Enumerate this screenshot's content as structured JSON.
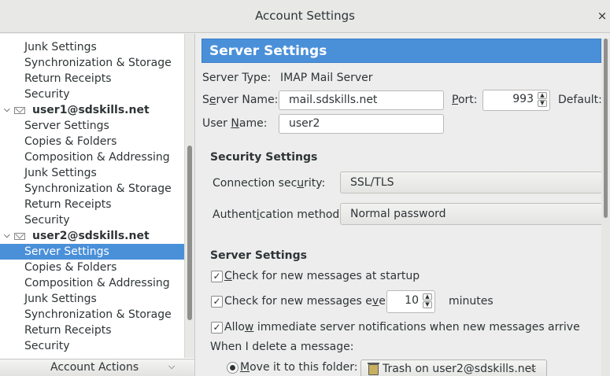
{
  "window": {
    "title": "Account Settings",
    "close_glyph": "×"
  },
  "sidebar": {
    "items": [
      {
        "label": "Junk Settings",
        "kind": "child"
      },
      {
        "label": "Synchronization & Storage",
        "kind": "child"
      },
      {
        "label": "Return Receipts",
        "kind": "child"
      },
      {
        "label": "Security",
        "kind": "child"
      },
      {
        "label": "user1@sdskills.net",
        "kind": "account"
      },
      {
        "label": "Server Settings",
        "kind": "child"
      },
      {
        "label": "Copies & Folders",
        "kind": "child"
      },
      {
        "label": "Composition & Addressing",
        "kind": "child"
      },
      {
        "label": "Junk Settings",
        "kind": "child"
      },
      {
        "label": "Synchronization & Storage",
        "kind": "child"
      },
      {
        "label": "Return Receipts",
        "kind": "child"
      },
      {
        "label": "Security",
        "kind": "child"
      },
      {
        "label": "user2@sdskills.net",
        "kind": "account"
      },
      {
        "label": "Server Settings",
        "kind": "child",
        "selected": true
      },
      {
        "label": "Copies & Folders",
        "kind": "child"
      },
      {
        "label": "Composition & Addressing",
        "kind": "child"
      },
      {
        "label": "Junk Settings",
        "kind": "child"
      },
      {
        "label": "Synchronization & Storage",
        "kind": "child"
      },
      {
        "label": "Return Receipts",
        "kind": "child"
      },
      {
        "label": "Security",
        "kind": "child"
      }
    ],
    "account_actions_label": "Account Actions",
    "selection_color": "#4a90d9"
  },
  "main": {
    "header": "Server Settings",
    "server_type_label": "Server Type:",
    "server_type_value": "IMAP Mail Server",
    "server_name_label_pre": "S",
    "server_name_label_ul": "e",
    "server_name_label_post": "rver Name:",
    "server_name_value": "mail.sdskills.net",
    "port_label_ul": "P",
    "port_label_post": "ort:",
    "port_value": "993",
    "default_label": "Default:",
    "user_name_label_pre": "User ",
    "user_name_label_ul": "N",
    "user_name_label_post": "ame:",
    "user_name_value": "user2",
    "security_section": "Security Settings",
    "connection_security_label_pre": "Connection sec",
    "connection_security_label_ul": "u",
    "connection_security_label_post": "rity:",
    "connection_security_value": "SSL/TLS",
    "auth_method_label_pre": "Authent",
    "auth_method_label_ul": "i",
    "auth_method_label_post": "cation method:",
    "auth_method_value": "Normal password",
    "server_section": "Server Settings",
    "check_startup_ul": "C",
    "check_startup_post": "heck for new messages at startup",
    "check_every_pre": "Check for new messages e",
    "check_every_ul": "v",
    "check_every_post": "ery",
    "check_every_value": "10",
    "minutes_label": "minutes",
    "allow_notify_pre": "Allo",
    "allow_notify_ul": "w",
    "allow_notify_post": " immediate server notifications when new messages arrive",
    "delete_label": "When I delete a message:",
    "move_to_folder_ul": "M",
    "move_to_folder_post": "ove it to this folder:",
    "trash_folder": "Trash on user2@sdskills.net",
    "accent": "#4a90d9"
  }
}
